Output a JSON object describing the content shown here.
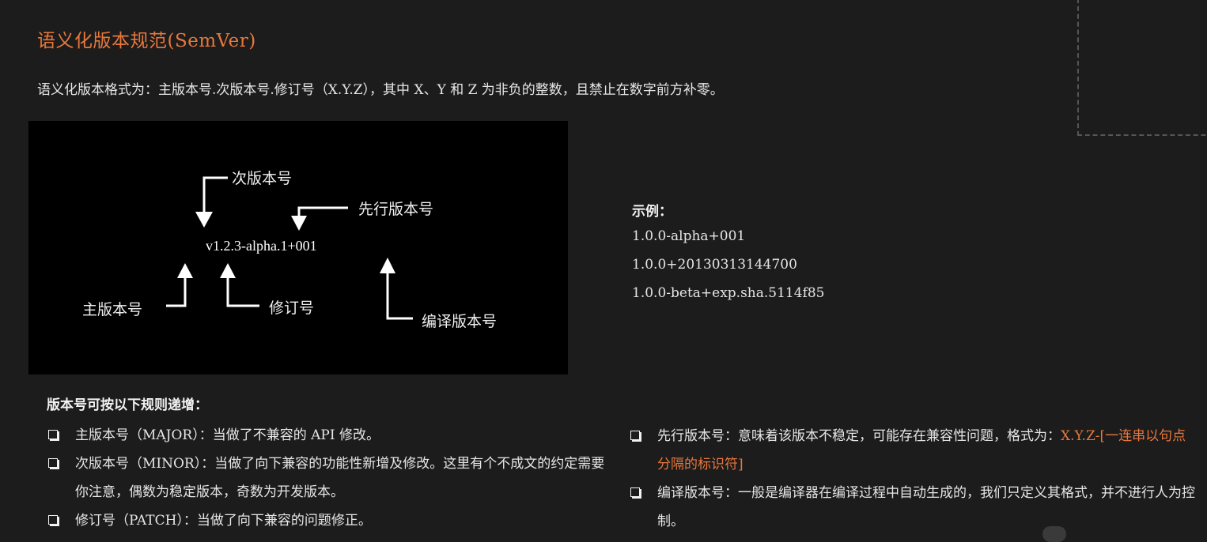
{
  "title": "语义化版本规范(SemVer)",
  "intro": "语义化版本格式为：主版本号.次版本号.修订号（X.Y.Z），其中 X、Y 和 Z 为非负的整数，且禁止在数字前方补零。",
  "diagram": {
    "version_string": "v1.2.3-alpha.1+001",
    "labels": {
      "minor": "次版本号",
      "prerelease": "先行版本号",
      "major": "主版本号",
      "patch": "修订号",
      "build": "编译版本号"
    }
  },
  "examples": {
    "title": "示例：",
    "items": [
      "1.0.0-alpha+001",
      "1.0.0+20130313144700",
      "1.0.0-beta+exp.sha.5114f85"
    ]
  },
  "rules": {
    "title": "版本号可按以下规则递增：",
    "left": [
      "主版本号（MAJOR）：当做了不兼容的 API 修改。",
      "次版本号（MINOR）：当做了向下兼容的功能性新增及修改。这里有个不成文的约定需要你注意，偶数为稳定版本，奇数为开发版本。",
      "修订号（PATCH）：当做了向下兼容的问题修正。"
    ],
    "right": [
      {
        "text": "先行版本号：意味着该版本不稳定，可能存在兼容性问题，格式为：",
        "accent": "X.Y.Z-[一连串以句点分隔的标识符]"
      },
      {
        "text": "编译版本号：一般是编译器在编译过程中自动生成的，我们只定义其格式，并不进行人为控制。",
        "accent": ""
      }
    ]
  },
  "colors": {
    "background": "#1c1c1c",
    "accent": "#e8773c",
    "diagram_bg": "#000000",
    "text": "#e6e6e6"
  },
  "icons": {
    "bullet": "checkbox-bullet-icon",
    "arrow": "arrow-icon"
  }
}
